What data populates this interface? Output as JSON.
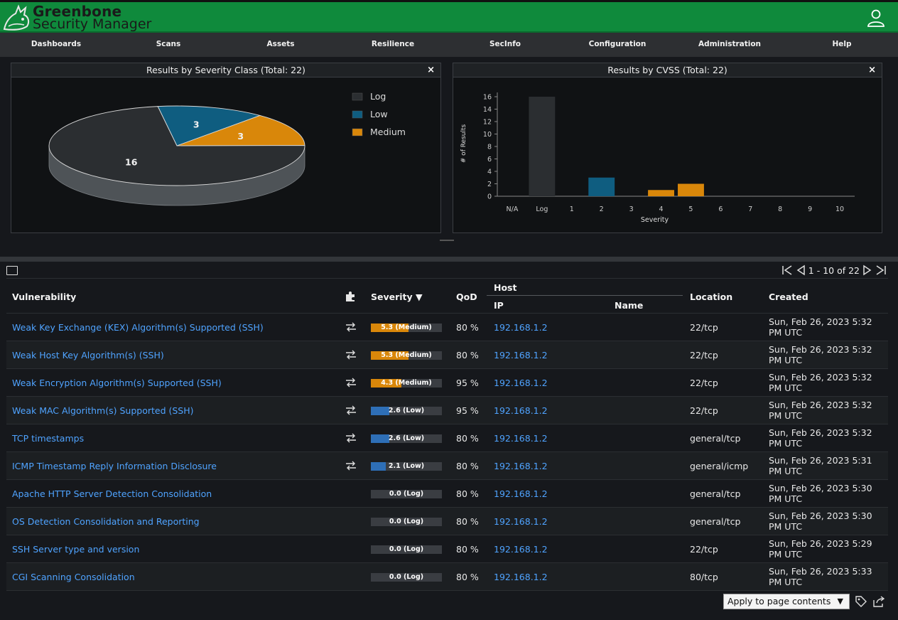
{
  "app": {
    "brand_line1": "Greenbone",
    "brand_line2": "Security Manager",
    "logo_icon": "greenbone-dragon-icon",
    "user_icon": "user-icon"
  },
  "menu": [
    "Dashboards",
    "Scans",
    "Assets",
    "Resilience",
    "SecInfo",
    "Configuration",
    "Administration",
    "Help"
  ],
  "panels": [
    {
      "title": "Results by Severity Class (Total: 22)",
      "close": "×"
    },
    {
      "title": "Results by CVSS (Total: 22)",
      "close": "×"
    }
  ],
  "chart_data": [
    {
      "type": "pie",
      "title": "Results by Severity Class (Total: 22)",
      "slices": [
        {
          "label": "Log",
          "value": 16,
          "color": "#2b2e31"
        },
        {
          "label": "Low",
          "value": 3,
          "color": "#0f5d80"
        },
        {
          "label": "Medium",
          "value": 3,
          "color": "#d9870a"
        }
      ],
      "legend": [
        "Log",
        "Low",
        "Medium"
      ],
      "legend_position": "right"
    },
    {
      "type": "bar",
      "title": "Results by CVSS (Total: 22)",
      "categories": [
        "N/A",
        "Log",
        "1",
        "2",
        "3",
        "4",
        "5",
        "6",
        "7",
        "8",
        "9",
        "10"
      ],
      "values": [
        0,
        16,
        0,
        3,
        0,
        1,
        2,
        0,
        0,
        0,
        0,
        0
      ],
      "colors": [
        "#2b2e31",
        "#2b2e31",
        "#0f5d80",
        "#0f5d80",
        "#0f5d80",
        "#d9870a",
        "#d9870a",
        "#d9870a",
        "#c0392b",
        "#c0392b",
        "#c0392b",
        "#c0392b"
      ],
      "xlabel": "Severity",
      "ylabel": "# of Results",
      "yticks": [
        0,
        2,
        4,
        6,
        8,
        10,
        12,
        14,
        16
      ],
      "ylim": [
        0,
        16
      ]
    }
  ],
  "pager": {
    "text": "1 - 10 of 22"
  },
  "table": {
    "headers": {
      "vulnerability": "Vulnerability",
      "severity": "Severity ▼",
      "qod": "QoD",
      "host": "Host",
      "ip": "IP",
      "name": "Name",
      "location": "Location",
      "created": "Created"
    },
    "rows": [
      {
        "name": "Weak Key Exchange (KEX) Algorithm(s) Supported (SSH)",
        "override": true,
        "sev": 5.3,
        "sev_text": "5.3 (Medium)",
        "qod": "80 %",
        "ip": "192.168.1.2",
        "host": "",
        "location": "22/tcp",
        "created1": "Sun, Feb 26, 2023 5:32",
        "created2": "PM UTC"
      },
      {
        "name": "Weak Host Key Algorithm(s) (SSH)",
        "override": true,
        "sev": 5.3,
        "sev_text": "5.3 (Medium)",
        "qod": "80 %",
        "ip": "192.168.1.2",
        "host": "",
        "location": "22/tcp",
        "created1": "Sun, Feb 26, 2023 5:32",
        "created2": "PM UTC"
      },
      {
        "name": "Weak Encryption Algorithm(s) Supported (SSH)",
        "override": true,
        "sev": 4.3,
        "sev_text": "4.3 (Medium)",
        "qod": "95 %",
        "ip": "192.168.1.2",
        "host": "",
        "location": "22/tcp",
        "created1": "Sun, Feb 26, 2023 5:32",
        "created2": "PM UTC"
      },
      {
        "name": "Weak MAC Algorithm(s) Supported (SSH)",
        "override": true,
        "sev": 2.6,
        "sev_text": "2.6 (Low)",
        "qod": "95 %",
        "ip": "192.168.1.2",
        "host": "",
        "location": "22/tcp",
        "created1": "Sun, Feb 26, 2023 5:32",
        "created2": "PM UTC"
      },
      {
        "name": "TCP timestamps",
        "override": true,
        "sev": 2.6,
        "sev_text": "2.6 (Low)",
        "qod": "80 %",
        "ip": "192.168.1.2",
        "host": "",
        "location": "general/tcp",
        "created1": "Sun, Feb 26, 2023 5:32",
        "created2": "PM UTC"
      },
      {
        "name": "ICMP Timestamp Reply Information Disclosure",
        "override": true,
        "sev": 2.1,
        "sev_text": "2.1 (Low)",
        "qod": "80 %",
        "ip": "192.168.1.2",
        "host": "",
        "location": "general/icmp",
        "created1": "Sun, Feb 26, 2023 5:31",
        "created2": "PM UTC"
      },
      {
        "name": "Apache HTTP Server Detection Consolidation",
        "override": false,
        "sev": 0.0,
        "sev_text": "0.0 (Log)",
        "qod": "80 %",
        "ip": "192.168.1.2",
        "host": "",
        "location": "general/tcp",
        "created1": "Sun, Feb 26, 2023 5:30",
        "created2": "PM UTC"
      },
      {
        "name": "OS Detection Consolidation and Reporting",
        "override": false,
        "sev": 0.0,
        "sev_text": "0.0 (Log)",
        "qod": "80 %",
        "ip": "192.168.1.2",
        "host": "",
        "location": "general/tcp",
        "created1": "Sun, Feb 26, 2023 5:30",
        "created2": "PM UTC"
      },
      {
        "name": "SSH Server type and version",
        "override": false,
        "sev": 0.0,
        "sev_text": "0.0 (Log)",
        "qod": "80 %",
        "ip": "192.168.1.2",
        "host": "",
        "location": "22/tcp",
        "created1": "Sun, Feb 26, 2023 5:29",
        "created2": "PM UTC"
      },
      {
        "name": "CGI Scanning Consolidation",
        "override": false,
        "sev": 0.0,
        "sev_text": "0.0 (Log)",
        "qod": "80 %",
        "ip": "192.168.1.2",
        "host": "",
        "location": "80/tcp",
        "created1": "Sun, Feb 26, 2023 5:33",
        "created2": "PM UTC"
      }
    ]
  },
  "footer": {
    "apply_select": "Apply to page contents",
    "caret": "▼",
    "tag_icon": "tag-icon",
    "export_icon": "export-icon"
  },
  "colors": {
    "brand": "#0f8a3c",
    "medium": "#d9870a",
    "low": "#2e6fb7",
    "log": "#2b2e31",
    "link": "#4fa3ff"
  }
}
